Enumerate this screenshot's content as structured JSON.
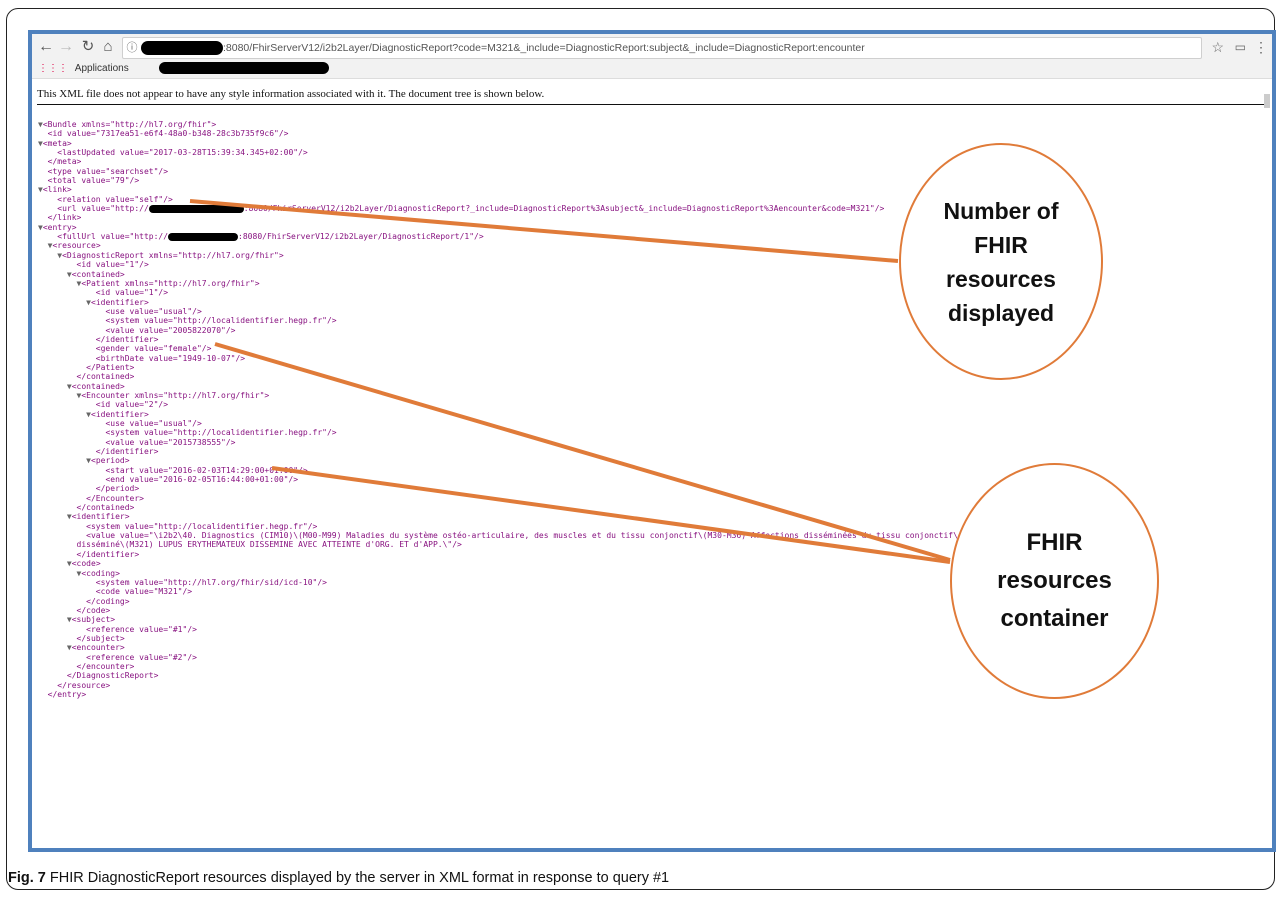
{
  "browser": {
    "url_suffix": ":8080/FhirServerV12/i2b2Layer/DiagnosticReport?code=M321&_include=DiagnosticReport:subject&_include=DiagnosticReport:encounter",
    "bookmarks_label": "Applications"
  },
  "notice": "This XML file does not appear to have any style information associated with it. The document tree is shown below.",
  "xml": {
    "l0": "<Bundle xmlns=\"http://hl7.org/fhir\">",
    "l1": "<id value=\"7317ea51-e6f4-48a0-b348-28c3b735f9c6\"/>",
    "l2": "<meta>",
    "l3": "<lastUpdated value=\"2017-03-28T15:39:34.345+02:00\"/>",
    "l4": "</meta>",
    "l5": "<type value=\"searchset\"/>",
    "l6": "<total value=\"79\"/>",
    "l7": "<link>",
    "l8": "<relation value=\"self\"/>",
    "l9a": "<url value=\"http://",
    "l9b": ":8080/FhirServerV12/i2b2Layer/DiagnosticReport?_include=DiagnosticReport%3Asubject&_include=DiagnosticReport%3Aencounter&code=M321\"/>",
    "l10": "</link>",
    "l11": "<entry>",
    "l12a": "<fullUrl value=\"http://",
    "l12b": ":8080/FhirServerV12/i2b2Layer/DiagnosticReport/1\"/>",
    "l13": "<resource>",
    "l14": "<DiagnosticReport xmlns=\"http://hl7.org/fhir\">",
    "l15": "<id value=\"1\"/>",
    "l16": "<contained>",
    "l17": "<Patient xmlns=\"http://hl7.org/fhir\">",
    "l18": "<id value=\"1\"/>",
    "l19": "<identifier>",
    "l20": "<use value=\"usual\"/>",
    "l21": "<system value=\"http://localidentifier.hegp.fr\"/>",
    "l22": "<value value=\"2005822070\"/>",
    "l23": "</identifier>",
    "l24": "<gender value=\"female\"/>",
    "l25": "<birthDate value=\"1949-10-07\"/>",
    "l26": "</Patient>",
    "l27": "</contained>",
    "l28": "<contained>",
    "l29": "<Encounter xmlns=\"http://hl7.org/fhir\">",
    "l30": "<id value=\"2\"/>",
    "l31": "<identifier>",
    "l32": "<use value=\"usual\"/>",
    "l33": "<system value=\"http://localidentifier.hegp.fr\"/>",
    "l34": "<value value=\"2015738555\"/>",
    "l35": "</identifier>",
    "l36": "<period>",
    "l37": "<start value=\"2016-02-03T14:29:00+01:00\"/>",
    "l38": "<end value=\"2016-02-05T16:44:00+01:00\"/>",
    "l39": "</period>",
    "l40": "</Encounter>",
    "l41": "</contained>",
    "l42": "<identifier>",
    "l43": "<system value=\"http://localidentifier.hegp.fr\"/>",
    "l44": "<value value=\"\\i2b2\\40. Diagnostics (CIM10)\\(M00-M99) Maladies du système ostéo-articulaire, des muscles et du tissu conjonctif\\(M30-M36) Affections disséminées du tissu conjonctif\\(M32) Lupus érythémateux",
    "l45": "disséminé\\(M321) LUPUS ERYTHEMATEUX DISSEMINE AVEC ATTEINTE d'ORG. ET d'APP.\\\"/>",
    "l46": "</identifier>",
    "l47": "<code>",
    "l48": "<coding>",
    "l49": "<system value=\"http://hl7.org/fhir/sid/icd-10\"/>",
    "l50": "<code value=\"M321\"/>",
    "l51": "</coding>",
    "l52": "</code>",
    "l53": "<subject>",
    "l54": "<reference value=\"#1\"/>",
    "l55": "</subject>",
    "l56": "<encounter>",
    "l57": "<reference value=\"#2\"/>",
    "l58": "</encounter>",
    "l59": "</DiagnosticReport>",
    "l60": "</resource>",
    "l61": "</entry>"
  },
  "annotations": {
    "number_line1": "Number of",
    "number_line2": "FHIR",
    "number_line3": "resources",
    "number_line4": "displayed",
    "container_line1": "FHIR",
    "container_line2": "resources",
    "container_line3": "container"
  },
  "caption": {
    "label": "Fig. 7",
    "text": " FHIR DiagnosticReport resources displayed by the server in XML format in response to query #1"
  },
  "colors": {
    "accent_orange": "#e07b39",
    "frame_blue": "#4f81bd"
  }
}
